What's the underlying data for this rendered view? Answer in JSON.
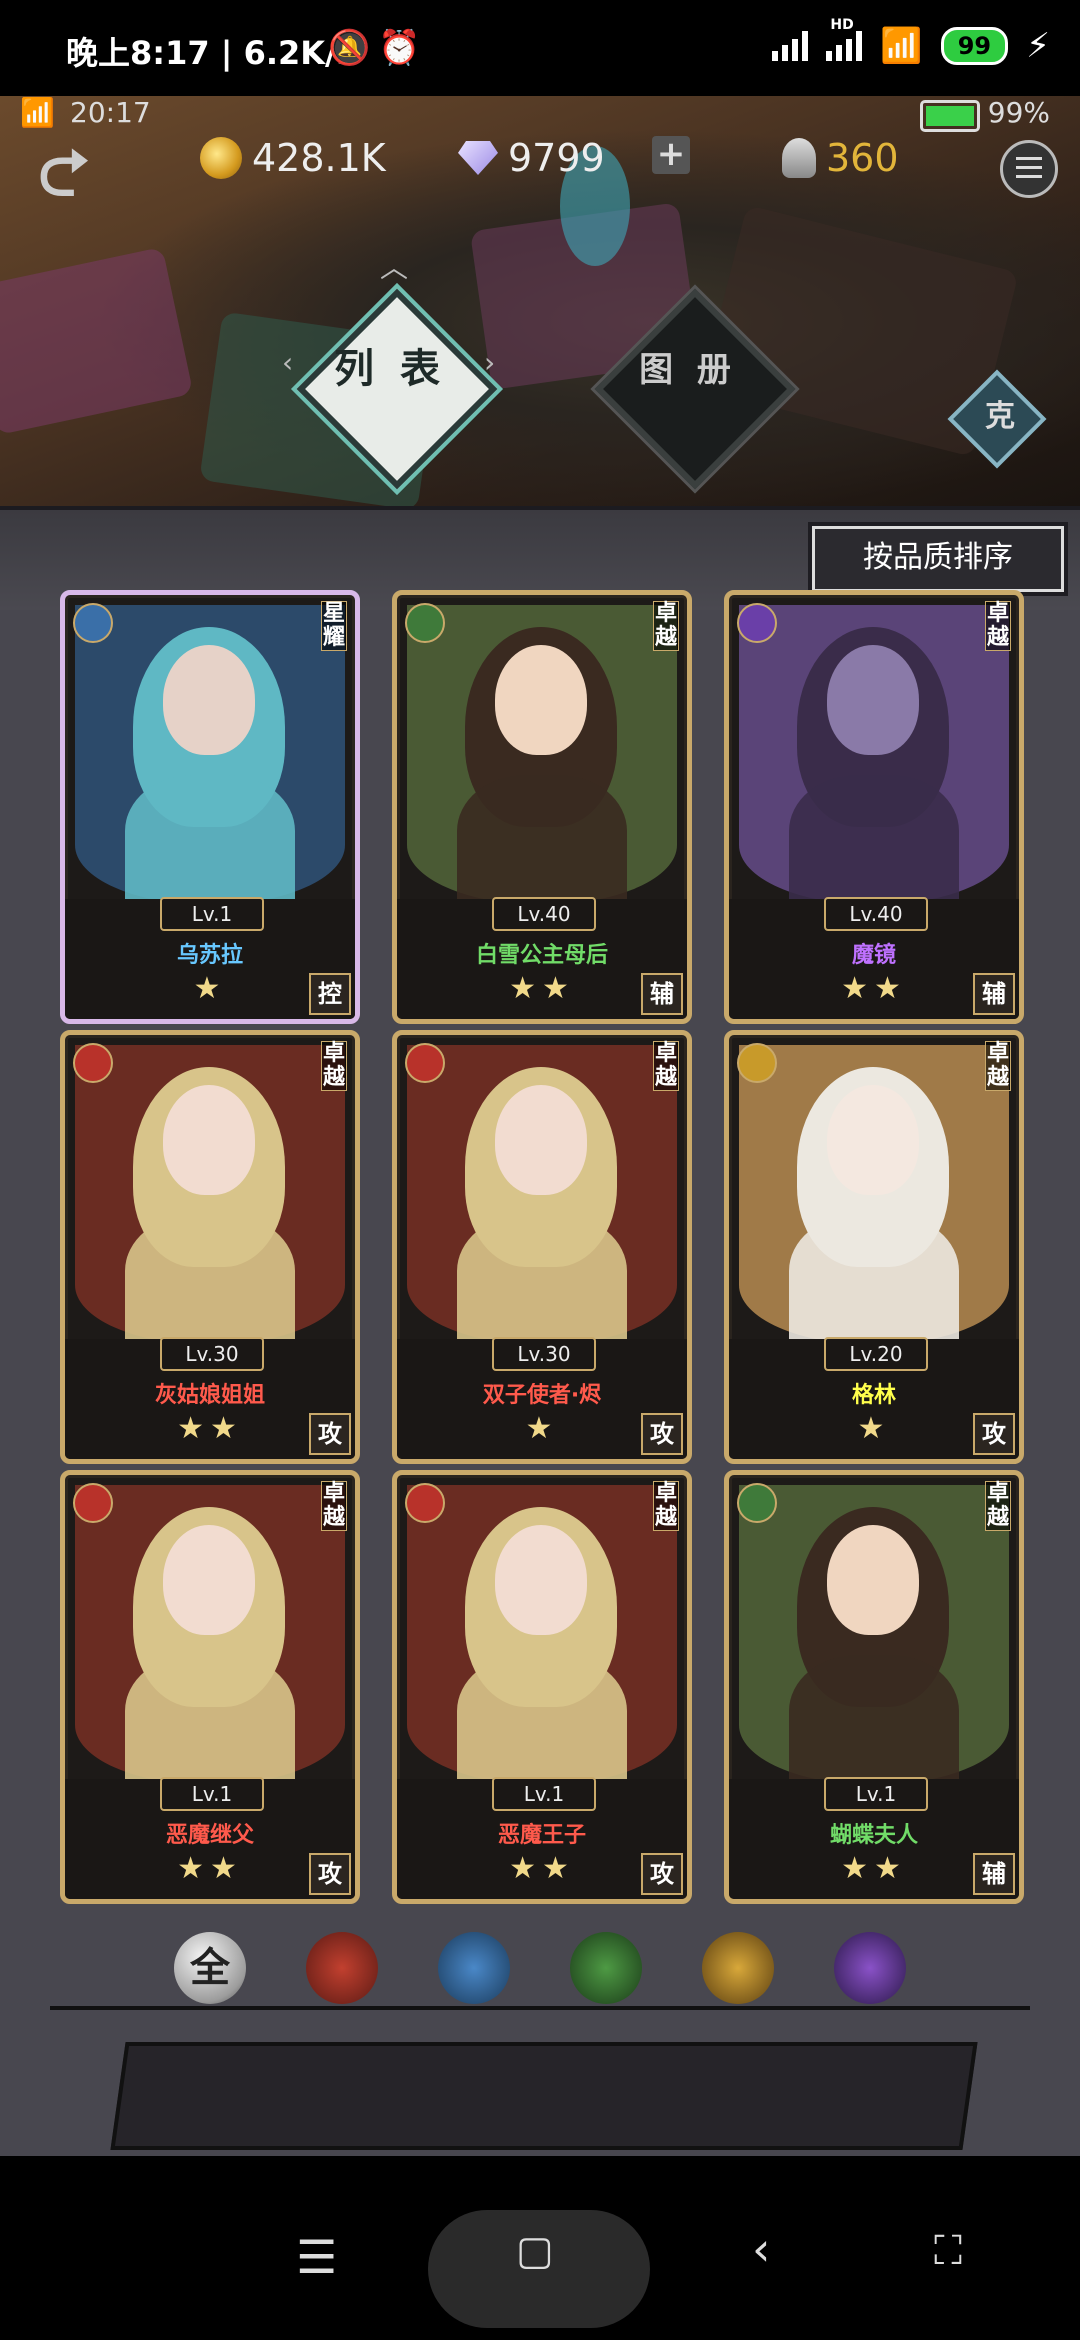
{
  "status_bar": {
    "left_text": "晚上8:17 | 6.2K/s",
    "battery": "99"
  },
  "game_status": {
    "time": "20:17",
    "battery_pct": "99%"
  },
  "resources": {
    "gold": "428.1K",
    "gems": "9799",
    "ink": "360"
  },
  "tabs": {
    "list": "列 表",
    "album": "图 册"
  },
  "counter_btn": "克",
  "sort_button": "按品质排序",
  "cards": [
    {
      "level": "Lv.1",
      "name": "乌苏拉",
      "stars": "★",
      "role": "控",
      "rarity": "星耀",
      "element": "water"
    },
    {
      "level": "Lv.40",
      "name": "白雪公主母后",
      "stars": "★★",
      "role": "辅",
      "rarity": "卓越",
      "element": "nature"
    },
    {
      "level": "Lv.40",
      "name": "魔镜",
      "stars": "★★",
      "role": "辅",
      "rarity": "卓越",
      "element": "moon"
    },
    {
      "level": "Lv.30",
      "name": "灰姑娘姐姐",
      "stars": "★★",
      "role": "攻",
      "rarity": "卓越",
      "element": "fire"
    },
    {
      "level": "Lv.30",
      "name": "双子使者·烬",
      "stars": "★",
      "role": "攻",
      "rarity": "卓越",
      "element": "fire"
    },
    {
      "level": "Lv.20",
      "name": "格林",
      "stars": "★",
      "role": "攻",
      "rarity": "卓越",
      "element": "light"
    },
    {
      "level": "Lv.1",
      "name": "恶魔继父",
      "stars": "★★",
      "role": "攻",
      "rarity": "卓越",
      "element": "fire"
    },
    {
      "level": "Lv.1",
      "name": "恶魔王子",
      "stars": "★★",
      "role": "攻",
      "rarity": "卓越",
      "element": "fire"
    },
    {
      "level": "Lv.1",
      "name": "蝴蝶夫人",
      "stars": "★★",
      "role": "辅",
      "rarity": "卓越",
      "element": "nature"
    }
  ],
  "filters": {
    "all": "全",
    "items": [
      "fire",
      "water",
      "nature",
      "light",
      "moon"
    ]
  },
  "colors": {
    "gold_frame": "#c9a96a",
    "fire": "#b8322a",
    "water": "#3a6fa8",
    "nature": "#3f7a3a",
    "light": "#c89a2a",
    "moon": "#6a3fa8"
  }
}
